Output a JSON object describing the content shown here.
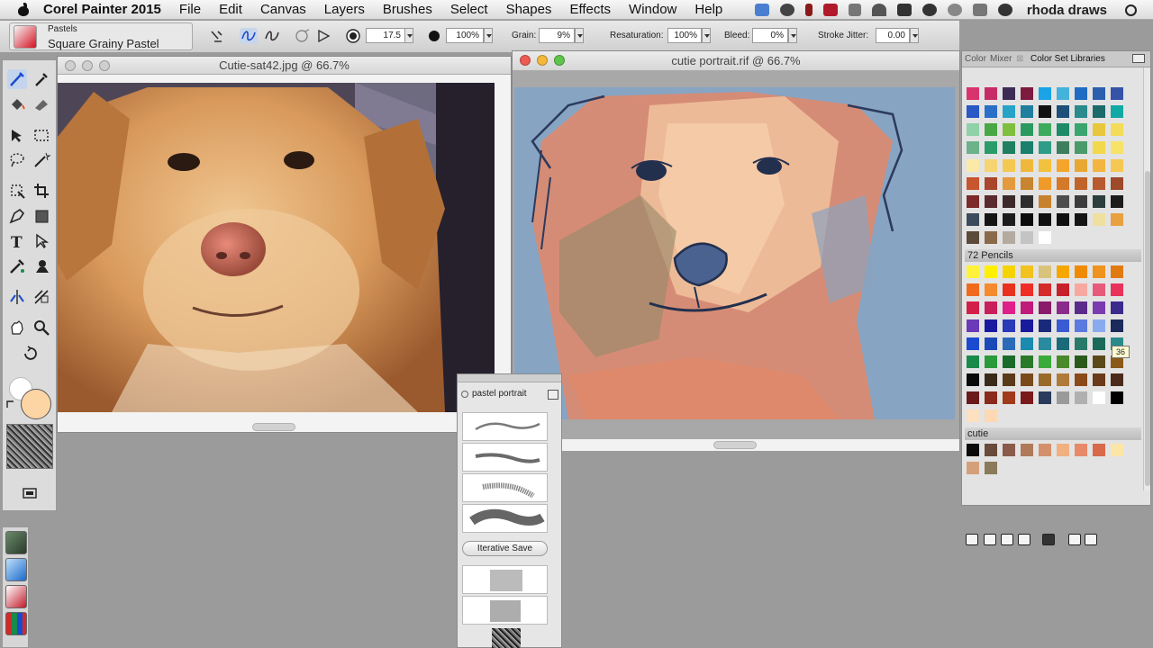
{
  "menubar": {
    "app": "Corel Painter 2015",
    "items": [
      "File",
      "Edit",
      "Canvas",
      "Layers",
      "Brushes",
      "Select",
      "Shapes",
      "Effects",
      "Window",
      "Help"
    ],
    "user": "rhoda draws"
  },
  "propbar": {
    "brush_category": "Pastels",
    "brush_variant": "Square Grainy Pastel",
    "size": "17.5",
    "opacity": "100%",
    "grain_label": "Grain:",
    "grain": "9%",
    "resaturation_label": "Resaturation:",
    "resaturation": "100%",
    "bleed_label": "Bleed:",
    "bleed": "0%",
    "jitter_label": "Stroke Jitter:",
    "jitter": "0.00"
  },
  "colors": {
    "main_color": "#fdd5a5",
    "additional_color": "#ffffff"
  },
  "windows": {
    "photo_title": "Cutie-sat42.jpg @ 66.7%",
    "painting_title": "cutie portrait.rif @ 66.7%"
  },
  "custom_palette": {
    "title": "pastel portrait",
    "iterative_save": "Iterative Save"
  },
  "color_panel": {
    "tabs": [
      "Color",
      "Mixer",
      "Color Set Libraries"
    ],
    "sections": [
      {
        "name": "",
        "colors": [
          "#d9336e",
          "#c72b66",
          "#3c2b55",
          "#7c1a3f",
          "#1aa3e6",
          "#44b3dc",
          "#1f6cc4",
          "#2b5fae",
          "#3554a8",
          "#2a58c4",
          "#2a70c8",
          "#28a3c8",
          "#1f7f9c",
          "#111111",
          "#1e4f78",
          "#2a8a8c",
          "#1b6b6b",
          "#12a9a4",
          "#8fd1a8",
          "#49a845",
          "#7fbf3f",
          "#2a9a5e",
          "#3dab5e",
          "#1d8a68",
          "#3aa56e",
          "#e8c73c",
          "#f3dc5a",
          "#6cb28b",
          "#2a9c6a",
          "#1f7f60",
          "#1a7f6c",
          "#2e9c86",
          "#3d7e5e",
          "#4a9a6a",
          "#f2d94c",
          "#f7e36a",
          "#fbe9a8",
          "#f7d472",
          "#f5c850",
          "#f0b83a",
          "#f2c23e",
          "#f5a52c",
          "#e8a832",
          "#f3b540",
          "#f6c752",
          "#c7552e",
          "#a8452a",
          "#e29a3c",
          "#c8842e",
          "#f09a2a",
          "#d4782a",
          "#c0642a",
          "#b85a2e",
          "#9c4a2a",
          "#7c2a2a",
          "#5a2a2e",
          "#3c2a2a",
          "#2e2e2e",
          "#c8822e",
          "#4e4e4e",
          "#3c3c3c",
          "#2c3e3e",
          "#1c1c1c",
          "#3c4c5c",
          "#141414",
          "#1c1c1c",
          "#0c0c0c",
          "#111111",
          "#0f0f0f",
          "#151515",
          "#efe0a0",
          "#e8a040",
          "#5c4a3a",
          "#8a6a4a",
          "#b4aaa0",
          "#c4c4c4",
          "#ffffff"
        ]
      },
      {
        "name": "72 Pencils",
        "colors": [
          "#fff23a",
          "#fff000",
          "#f5d300",
          "#f2c21e",
          "#d9c37a",
          "#f5a700",
          "#f08a00",
          "#f0921e",
          "#e27a12",
          "#f06a1e",
          "#f58a2e",
          "#e8321e",
          "#ef2e28",
          "#d42a2a",
          "#c8202a",
          "#f7a9a0",
          "#e85a7a",
          "#e8325a",
          "#d41e4a",
          "#c81e5a",
          "#e0208a",
          "#c01a7a",
          "#8a1a6a",
          "#8a2a8a",
          "#5a2a8a",
          "#7a3ab0",
          "#3c2a8c",
          "#6a3ab8",
          "#1a1aa0",
          "#2a3ab8",
          "#1a1a9c",
          "#1a2a7a",
          "#3a5ad4",
          "#5a7ae0",
          "#8aaaf0",
          "#1a2a5a",
          "#1a4ad0",
          "#1a4ab8",
          "#2a6ab8",
          "#1a8ab0",
          "#2a8aa0",
          "#1a6a7a",
          "#2a7a6a",
          "#1a6a5a",
          "#2a8a8a",
          "#1a8a4a",
          "#2a9a3a",
          "#1a6a2a",
          "#2a7a2a",
          "#3aaa3a",
          "#4a8a2a",
          "#2a5a1a",
          "#5a4a1a",
          "#8a5a1a",
          "#0a0a0a",
          "#3a2a1a",
          "#5a3a1a",
          "#7a4a1a",
          "#9a6a2a",
          "#b07a3a",
          "#8a4a1a",
          "#6a3a1a",
          "#4a2a1a",
          "#6a1a1a",
          "#8a2a1a",
          "#a03a1a",
          "#7a1a1a",
          "#2a3a5a",
          "#9a9a9a",
          "#b0b0b0",
          "#ffffff",
          "#000000",
          "#fde0c0",
          "#fcd8b4"
        ]
      },
      {
        "name": "cutie",
        "colors": [
          "#0a0a0a",
          "#6a4a3a",
          "#8a5a4a",
          "#b07a5a",
          "#d4906a",
          "#f0b080",
          "#e88a6a",
          "#d86a4a",
          "#fbe6a8",
          "#d4a07a",
          "#8a7a5a"
        ]
      }
    ],
    "tooltip": "36"
  }
}
